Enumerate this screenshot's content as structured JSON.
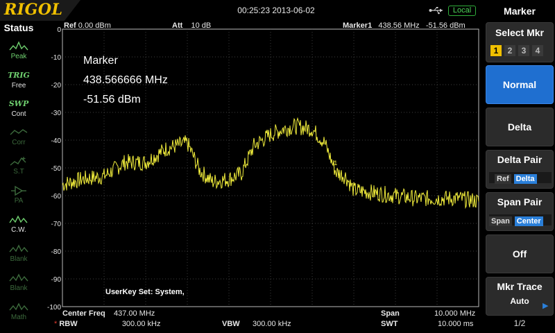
{
  "topbar": {
    "logo": "RIGOL",
    "datetime": "00:25:23 2013-06-02",
    "usb_icon": "usb-icon",
    "remote_status": "Local"
  },
  "status": {
    "title": "Status",
    "items": [
      {
        "icon": "peak-icon",
        "label": "Peak",
        "state": "on"
      },
      {
        "icon": "trig-icon",
        "top": "TRIG",
        "label": "Free",
        "state": "on"
      },
      {
        "icon": "sweep-icon",
        "top": "SWP",
        "label": "Cont",
        "state": "on"
      },
      {
        "icon": "corr-icon",
        "label": "Corr",
        "state": "off"
      },
      {
        "icon": "st-icon",
        "label": "S.T",
        "state": "off"
      },
      {
        "icon": "pa-icon",
        "label": "PA",
        "state": "off"
      },
      {
        "icon": "cw-icon",
        "label": "C.W.",
        "state": "on"
      },
      {
        "icon": "blank-icon",
        "label": "Blank",
        "state": "off"
      },
      {
        "icon": "blank-icon",
        "label": "Blank",
        "state": "off"
      },
      {
        "icon": "math-icon",
        "label": "Math",
        "state": "off"
      }
    ]
  },
  "header": {
    "ref_key": "Ref",
    "ref_value": "0.00 dBm",
    "att_key": "Att",
    "att_value": "10 dB",
    "marker_key": "Marker1",
    "marker_freq": "438.56 MHz",
    "marker_level": "-51.56 dBm"
  },
  "marker_readout": {
    "title": "Marker",
    "freq": "438.566666 MHz",
    "level": "-51.56 dBm",
    "label": "1"
  },
  "userkey": "UserKey Set:    System,",
  "bottom": {
    "center_key": "Center Freq",
    "center_value": "437.00 MHz",
    "rbw_key": "RBW",
    "rbw_value": "300.00 kHz",
    "vbw_key": "VBW",
    "vbw_value": "300.00 kHz",
    "span_key": "Span",
    "span_value": "10.000 MHz",
    "swt_key": "SWT",
    "swt_value": "10.000 ms",
    "star": "*"
  },
  "menu": {
    "title": "Marker",
    "select_label": "Select Mkr",
    "markers": [
      "1",
      "2",
      "3",
      "4"
    ],
    "selected_marker": "1",
    "normal_label": "Normal",
    "delta_label": "Delta",
    "delta_pair_label": "Delta Pair",
    "delta_pair_options": [
      "Ref",
      "Delta"
    ],
    "delta_pair_selected": "Delta",
    "span_pair_label": "Span Pair",
    "span_pair_options": [
      "Span",
      "Center"
    ],
    "span_pair_selected": "Center",
    "off_label": "Off",
    "mkr_trace_label": "Mkr Trace",
    "mkr_trace_value": "Auto",
    "page": "1/2",
    "accent_color": "#1f6fd0"
  },
  "chart_data": {
    "type": "line",
    "y_ticks": [
      "0",
      "-10",
      "-20",
      "-30",
      "-40",
      "-50",
      "-60",
      "-70",
      "-80",
      "-90",
      "-100"
    ],
    "ylim": [
      -100,
      0
    ],
    "xlim": [
      432.0,
      442.0
    ],
    "grid": true,
    "trace_color": "#f2ee3c",
    "series": [
      {
        "x": [
          432.0,
          432.5,
          433.0,
          433.5,
          434.0,
          434.5,
          435.0,
          435.3,
          435.6,
          436.0,
          436.3,
          436.6,
          437.0,
          437.3,
          437.6,
          438.0,
          438.3,
          438.57,
          438.8,
          439.0,
          439.5,
          440.0,
          440.5,
          441.0,
          441.5,
          442.0
        ],
        "y": [
          -56,
          -54,
          -53,
          -48,
          -48,
          -43,
          -41,
          -51,
          -55,
          -54,
          -52,
          -42,
          -38,
          -36,
          -35,
          -36,
          -41,
          -51.56,
          -53,
          -58,
          -59,
          -60,
          -61,
          -61,
          -61,
          -62
        ]
      }
    ]
  }
}
